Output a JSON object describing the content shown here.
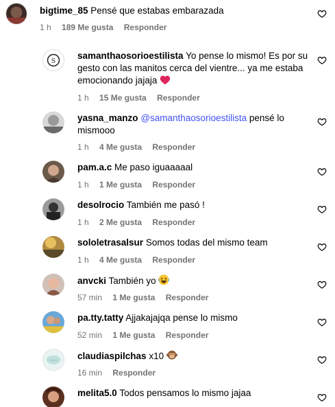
{
  "colors": {
    "mention": "#4150f7",
    "meta": "#737373",
    "heart_red": "#e0245e"
  },
  "comments": [
    {
      "user": "bigtime_85",
      "text": "Pensé que estabas embarazada",
      "time": "1 h",
      "likes": "189 Me gusta",
      "reply": "Responder"
    },
    {
      "user": "samanthaosorioestilista",
      "text": "Yo pense lo mismo! Es por su gesto con las manitos cerca del vientre... ya me estaba emocionando jajaja",
      "emoji": "red-heart",
      "time": "1 h",
      "likes": "15 Me gusta",
      "reply": "Responder"
    },
    {
      "user": "yasna_manzo",
      "mention": "@samanthaosorioestilista",
      "text": " pensé lo mismooo",
      "time": "1 h",
      "likes": "4 Me gusta",
      "reply": "Responder"
    },
    {
      "user": "pam.a.c",
      "text": "Me paso iguaaaaal",
      "time": "1 h",
      "likes": "1 Me gusta",
      "reply": "Responder"
    },
    {
      "user": "desolrocio",
      "text": "También me pasó !",
      "time": "1 h",
      "likes": "2 Me gusta",
      "reply": "Responder"
    },
    {
      "user": "sololetrasalsur",
      "text": "Somos todas del mismo team",
      "time": "1 h",
      "likes": "4 Me gusta",
      "reply": "Responder"
    },
    {
      "user": "anvcki",
      "text": "También yo",
      "emoji": "laughing-face",
      "time": "57 min",
      "likes": "1 Me gusta",
      "reply": "Responder"
    },
    {
      "user": "pa.tty.tatty",
      "text": "Ajjakajajqa pense lo mismo",
      "time": "52 min",
      "likes": "1 Me gusta",
      "reply": "Responder"
    },
    {
      "user": "claudiaspilchas",
      "text": "x10",
      "emoji": "see-no-evil-monkey",
      "time": "16 min",
      "reply": "Responder"
    },
    {
      "user": "melita5.0",
      "text": "Todos pensamos lo mismo jajaa"
    }
  ]
}
